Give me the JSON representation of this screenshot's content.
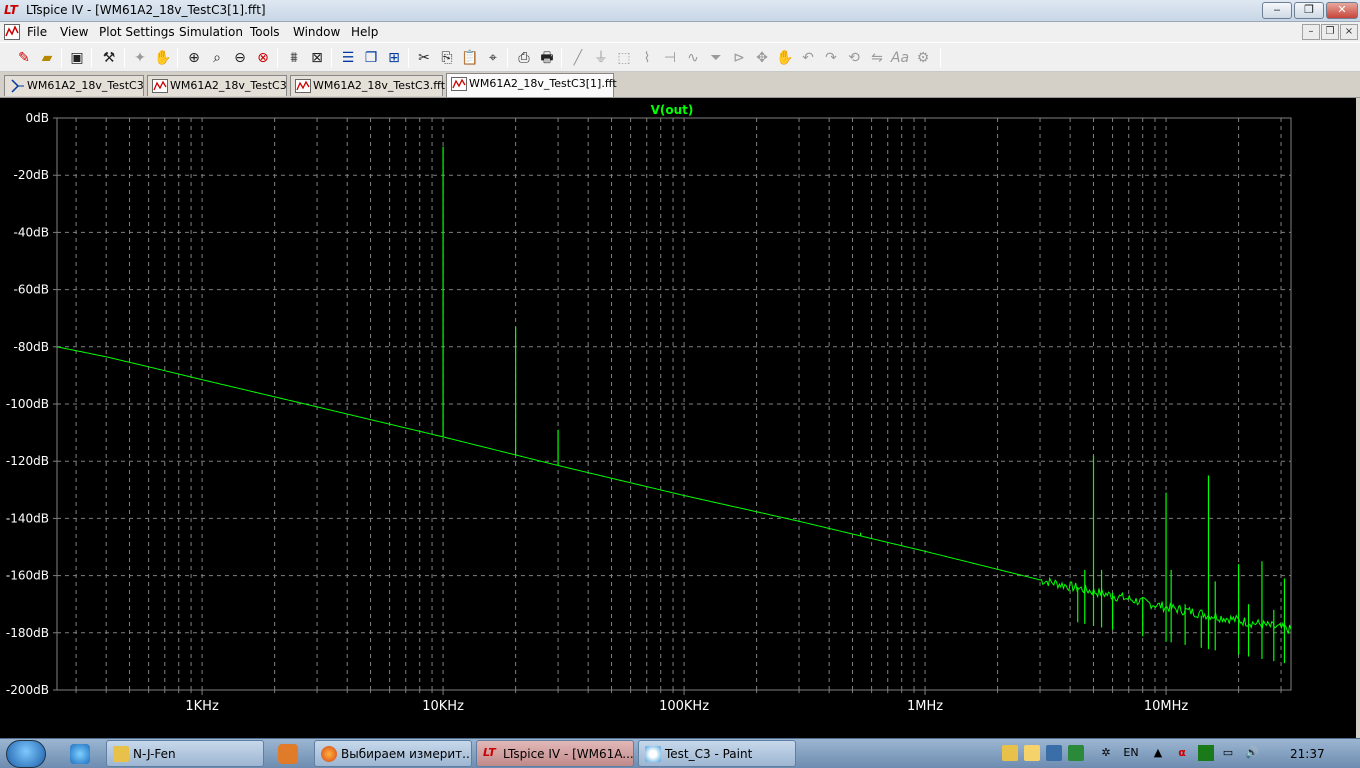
{
  "window": {
    "title": "LTspice IV - [WM61A2_18v_TestC3[1].fft]",
    "app_icon": "ltspice-logo-icon",
    "controls": {
      "minimize": "‒",
      "maximize": "❐",
      "close": "✕"
    }
  },
  "menu": {
    "items": [
      "File",
      "View",
      "Plot Settings",
      "Simulation",
      "Tools",
      "Window",
      "Help"
    ],
    "mdi_controls": {
      "minimize": "–",
      "restore": "❐",
      "close": "×"
    }
  },
  "toolbar": {
    "icons": [
      "open-schematic-icon",
      "open-file-icon",
      "save-icon",
      "control-panel-icon",
      "run-icon",
      "pan-hand-icon",
      "zoom-in-icon",
      "zoom-out-icon",
      "zoom-fit-icon",
      "zoom-cancel-icon",
      "autorange-icon",
      "zoom-extents-icon",
      "tile-horizontal-icon",
      "cascade-icon",
      "close-all-icon",
      "cut-icon",
      "copy-icon",
      "paste-icon",
      "find-icon",
      "print-preview-icon",
      "print-icon",
      "wire-icon",
      "ground-icon",
      "label-icon",
      "resistor-icon",
      "capacitor-icon",
      "inductor-icon",
      "diode-icon",
      "component-icon",
      "move-icon",
      "drag-icon",
      "undo-icon",
      "redo-icon",
      "rotate-icon",
      "mirror-icon",
      "text-icon",
      "spice-directive-icon"
    ]
  },
  "tabs": [
    {
      "label": "WM61A2_18v_TestC3",
      "icon": "schematic-icon",
      "active": false
    },
    {
      "label": "WM61A2_18v_TestC3",
      "icon": "waveform-icon",
      "active": false
    },
    {
      "label": "WM61A2_18v_TestC3.fft",
      "icon": "waveform-icon",
      "active": false
    },
    {
      "label": "WM61A2_18v_TestC3[1].fft",
      "icon": "waveform-icon",
      "active": true
    }
  ],
  "chart_data": {
    "type": "line",
    "title": "V(out)",
    "xlabel": "",
    "ylabel": "",
    "x_scale": "log",
    "xlim": [
      250,
      33000000
    ],
    "ylim": [
      -200,
      0
    ],
    "grid": true,
    "trace_color": "#00ff00",
    "background": "#000000",
    "y_ticks": [
      "0dB",
      "-20dB",
      "-40dB",
      "-60dB",
      "-80dB",
      "-100dB",
      "-120dB",
      "-140dB",
      "-160dB",
      "-180dB",
      "-200dB"
    ],
    "y_tick_values": [
      0,
      -20,
      -40,
      -60,
      -80,
      -100,
      -120,
      -140,
      -160,
      -180,
      -200
    ],
    "x_ticks": [
      "1KHz",
      "10KHz",
      "100KHz",
      "1MHz",
      "10MHz"
    ],
    "x_tick_values": [
      1000,
      10000,
      100000,
      1000000,
      10000000
    ],
    "series": [
      {
        "name": "V(out)",
        "baseline": [
          [
            250,
            -80
          ],
          [
            400,
            -83.5
          ],
          [
            600,
            -87
          ],
          [
            1000,
            -91.5
          ],
          [
            3000,
            -101
          ],
          [
            10000,
            -111.5
          ],
          [
            30000,
            -121.5
          ],
          [
            100000,
            -132
          ],
          [
            300000,
            -141
          ],
          [
            1000000,
            -151.5
          ],
          [
            3000000,
            -161.5
          ],
          [
            10000000,
            -171
          ],
          [
            33000000,
            -179
          ]
        ],
        "spikes": [
          [
            10000,
            -10
          ],
          [
            20000,
            -73
          ],
          [
            30000,
            -109
          ],
          [
            540000,
            -145
          ],
          [
            4300000,
            -164
          ],
          [
            4600000,
            -158
          ],
          [
            5000000,
            -118
          ],
          [
            5400000,
            -158
          ],
          [
            6000000,
            -166
          ],
          [
            8000000,
            -168
          ],
          [
            10000000,
            -131
          ],
          [
            10500000,
            -158
          ],
          [
            12000000,
            -170
          ],
          [
            14000000,
            -174
          ],
          [
            15000000,
            -125
          ],
          [
            16000000,
            -162
          ],
          [
            20000000,
            -156
          ],
          [
            22000000,
            -170
          ],
          [
            25000000,
            -155
          ],
          [
            28000000,
            -172
          ],
          [
            31000000,
            -161
          ]
        ]
      }
    ]
  },
  "taskbar": {
    "tasks": [
      {
        "label": "N-J-Fen",
        "icon": "folder-icon",
        "active": false
      },
      {
        "label": "Выбираем измерит...",
        "icon": "firefox-icon",
        "active": false
      },
      {
        "label": "LTspice IV - [WM61A...",
        "icon": "ltspice-icon",
        "active": true
      },
      {
        "label": "Test_C3 - Paint",
        "icon": "paint-icon",
        "active": false
      }
    ],
    "language": "EN",
    "clock": "21:37"
  }
}
